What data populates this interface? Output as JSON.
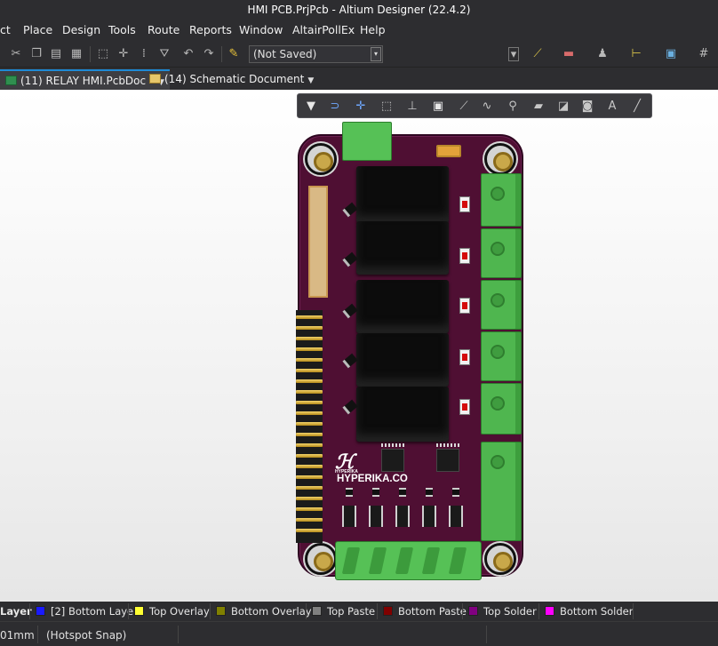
{
  "window": {
    "title": "HMI PCB.PrjPcb - Altium Designer (22.4.2)"
  },
  "menu": {
    "items": [
      "ct",
      "Place",
      "Design",
      "Tools",
      "Route",
      "Reports",
      "Window",
      "AltairPollEx",
      "Help"
    ]
  },
  "toolbar": {
    "saved_state": "(Not Saved)"
  },
  "tabs": [
    {
      "label": "(11) RELAY HMI.PcbDoc *",
      "active": true,
      "icon": "pcb-doc-icon"
    },
    {
      "label": "(14) Schematic Document",
      "active": false,
      "icon": "schematic-doc-icon"
    }
  ],
  "board": {
    "logo_small": "HYPERIKA",
    "logo_brand": "HYPERIKA.CO"
  },
  "layers": [
    {
      "label": "Layer",
      "color": null
    },
    {
      "label": "[2] Bottom Layer",
      "color": "#1a1aff"
    },
    {
      "label": "Top Overlay",
      "color": "#ffff33"
    },
    {
      "label": "Bottom Overlay",
      "color": "#808000"
    },
    {
      "label": "Top Paste",
      "color": "#808080"
    },
    {
      "label": "Bottom Paste",
      "color": "#800000"
    },
    {
      "label": "Top Solder",
      "color": "#800080"
    },
    {
      "label": "Bottom Solder",
      "color": "#ff00ff"
    }
  ],
  "status": {
    "grid": "01mm",
    "snap": "(Hotspot Snap)"
  }
}
